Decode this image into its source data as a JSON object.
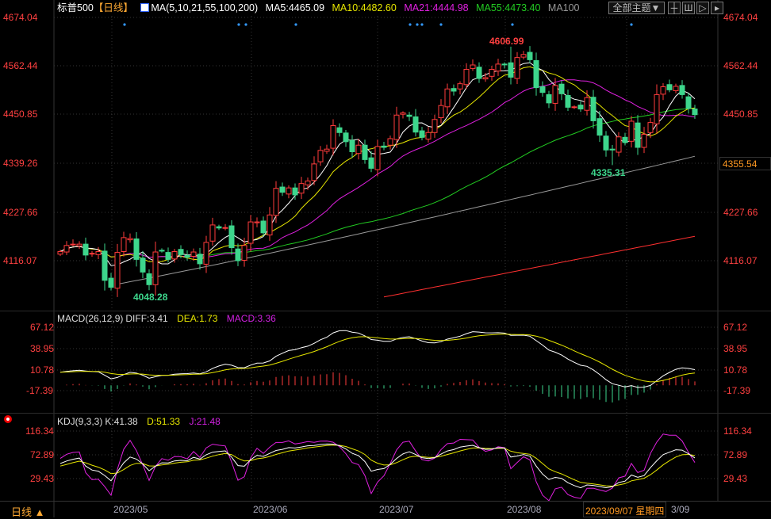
{
  "header": {
    "symbol": "标普500",
    "period": "【日线】",
    "ma_params": "MA(5,10,21,55,100,200)",
    "ma5": "MA5:4465.09",
    "ma10": "MA10:4482.60",
    "ma21": "MA21:4444.98",
    "ma55": "MA55:4473.40",
    "ma100": "MA100",
    "theme_button": "全部主题▼",
    "tool_icons": [
      "grid-icon",
      "chart-split-icon",
      "chart-play-icon",
      "chart-next-icon"
    ]
  },
  "colors": {
    "up": "#ff3b3b",
    "down": "#3dd68c",
    "ma5": "#ffffff",
    "ma10": "#e6e600",
    "ma21": "#e020e0",
    "ma55": "#22cc22",
    "ma100": "#999999",
    "ma200": "#ff3030",
    "axis": "#ff4040"
  },
  "main_axis": {
    "left": [
      "4674.04",
      "4562.44",
      "4450.85",
      "4339.26",
      "4227.66",
      "4116.07"
    ],
    "right": [
      "4674.04",
      "4562.44",
      "4450.85",
      "4227.66",
      "4116.07"
    ],
    "current_price": "4355.54"
  },
  "annotations": {
    "low1": "4048.28",
    "high": "4606.99",
    "low2": "4335.31"
  },
  "macd": {
    "title": "MACD(26,12,9)",
    "diff": "DIFF:3.41",
    "dea": "DEA:1.73",
    "macd": "MACD:3.36",
    "axis": [
      "67.12",
      "38.95",
      "10.78",
      "-17.39"
    ]
  },
  "kdj": {
    "title": "KDJ(9,3,3)",
    "k": "K:41.38",
    "d": "D:51.33",
    "j": "J:21.48",
    "axis": [
      "116.34",
      "72.89",
      "29.43"
    ]
  },
  "footer": {
    "period_button": "日线 ▲",
    "months": [
      "2023/05",
      "2023/06",
      "2023/07",
      "2023/08",
      "3/09"
    ],
    "crosshair_date": "2023/09/07 星期四"
  },
  "chart_data": {
    "type": "candlestick",
    "closes": [
      4137,
      4151,
      4154,
      4154,
      4129,
      4133,
      4137,
      4071,
      4055,
      4135,
      4169,
      4167,
      4119,
      4090,
      4061,
      4136,
      4138,
      4119,
      4137,
      4130,
      4124,
      4136,
      4109,
      4158,
      4198,
      4191,
      4192,
      4146,
      4116,
      4151,
      4205,
      4205,
      4180,
      4221,
      4282,
      4273,
      4283,
      4267,
      4293,
      4299,
      4338,
      4369,
      4372,
      4426,
      4410,
      4389,
      4366,
      4381,
      4348,
      4328,
      4378,
      4376,
      4396,
      4450,
      4455,
      4447,
      4411,
      4399,
      4410,
      4440,
      4472,
      4510,
      4505,
      4522,
      4555,
      4565,
      4534,
      4536,
      4555,
      4567,
      4566,
      4537,
      4582,
      4589,
      4577,
      4513,
      4502,
      4478,
      4518,
      4499,
      4468,
      4469,
      4464,
      4490,
      4437,
      4404,
      4370,
      4370,
      4400,
      4387,
      4436,
      4376,
      4406,
      4433,
      4497,
      4515,
      4508,
      4516,
      4497,
      4465,
      4451
    ],
    "month_start_index": [
      11,
      33,
      54,
      74,
      97
    ],
    "extremes": {
      "low1": {
        "index": 14,
        "value": 4048.28
      },
      "high": {
        "index": 71,
        "value": 4606.99
      },
      "low2": {
        "index": 87,
        "value": 4335.31
      }
    },
    "ma100_range": [
      4040,
      4355.54
    ],
    "ma200_range": [
      4030,
      4172
    ],
    "signal_dot_indices": [
      10,
      28,
      29,
      37,
      55,
      56,
      57,
      60,
      71,
      90
    ],
    "yrange": [
      4116.07,
      4674.04
    ]
  }
}
